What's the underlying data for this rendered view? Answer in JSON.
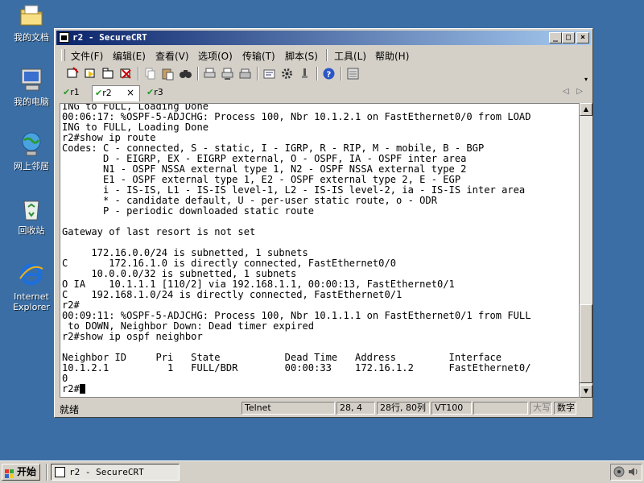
{
  "desktop": {
    "icons": [
      {
        "label": "我的文档"
      },
      {
        "label": "我的电脑"
      },
      {
        "label": "网上邻居"
      },
      {
        "label": "回收站"
      },
      {
        "label": "Internet Explorer"
      }
    ]
  },
  "window": {
    "title": "r2 - SecureCRT",
    "buttons": {
      "minimize": "_",
      "maximize": "□",
      "close": "×"
    }
  },
  "menu": {
    "items": [
      "文件(F)",
      "编辑(E)",
      "查看(V)",
      "选项(O)",
      "传输(T)",
      "脚本(S)",
      "工具(L)",
      "帮助(H)"
    ]
  },
  "toolbar": {
    "icons": [
      "connect-icon",
      "quick-connect-icon",
      "connect-in-tab-icon",
      "disconnect-icon",
      "copy-icon",
      "paste-icon",
      "find-icon",
      "print-icon",
      "print-selection-icon",
      "print-screen-icon",
      "session-options-icon",
      "global-options-icon",
      "keymap-icon",
      "help-icon",
      "keypad-icon"
    ]
  },
  "tabs": [
    {
      "label": "r1",
      "active": false
    },
    {
      "label": "r2",
      "active": true
    },
    {
      "label": "r3",
      "active": false
    }
  ],
  "terminal": {
    "lines": [
      "ING to FULL, Loading Done",
      "00:06:17: %OSPF-5-ADJCHG: Process 100, Nbr 10.1.2.1 on FastEthernet0/0 from LOAD",
      "ING to FULL, Loading Done",
      "r2#show ip route",
      "Codes: C - connected, S - static, I - IGRP, R - RIP, M - mobile, B - BGP",
      "       D - EIGRP, EX - EIGRP external, O - OSPF, IA - OSPF inter area",
      "       N1 - OSPF NSSA external type 1, N2 - OSPF NSSA external type 2",
      "       E1 - OSPF external type 1, E2 - OSPF external type 2, E - EGP",
      "       i - IS-IS, L1 - IS-IS level-1, L2 - IS-IS level-2, ia - IS-IS inter area",
      "       * - candidate default, U - per-user static route, o - ODR",
      "       P - periodic downloaded static route",
      "",
      "Gateway of last resort is not set",
      "",
      "     172.16.0.0/24 is subnetted, 1 subnets",
      "C       172.16.1.0 is directly connected, FastEthernet0/0",
      "     10.0.0.0/32 is subnetted, 1 subnets",
      "O IA    10.1.1.1 [110/2] via 192.168.1.1, 00:00:13, FastEthernet0/1",
      "C    192.168.1.0/24 is directly connected, FastEthernet0/1",
      "r2#",
      "00:09:11: %OSPF-5-ADJCHG: Process 100, Nbr 10.1.1.1 on FastEthernet0/1 from FULL",
      " to DOWN, Neighbor Down: Dead timer expired",
      "r2#show ip ospf neighbor",
      "",
      "Neighbor ID     Pri   State           Dead Time   Address         Interface",
      "10.1.2.1          1   FULL/BDR        00:00:33    172.16.1.2      FastEthernet0/",
      "0"
    ],
    "prompt": "r2#"
  },
  "status": {
    "ready": "就绪",
    "protocol": "Telnet",
    "cursor_pos": "28,  4",
    "size": "28行, 80列",
    "emulation": "VT100",
    "blank": "",
    "caps": "大写",
    "num": "数字"
  },
  "taskbar": {
    "start_label": "开始",
    "task_label": "r2 - SecureCRT"
  }
}
